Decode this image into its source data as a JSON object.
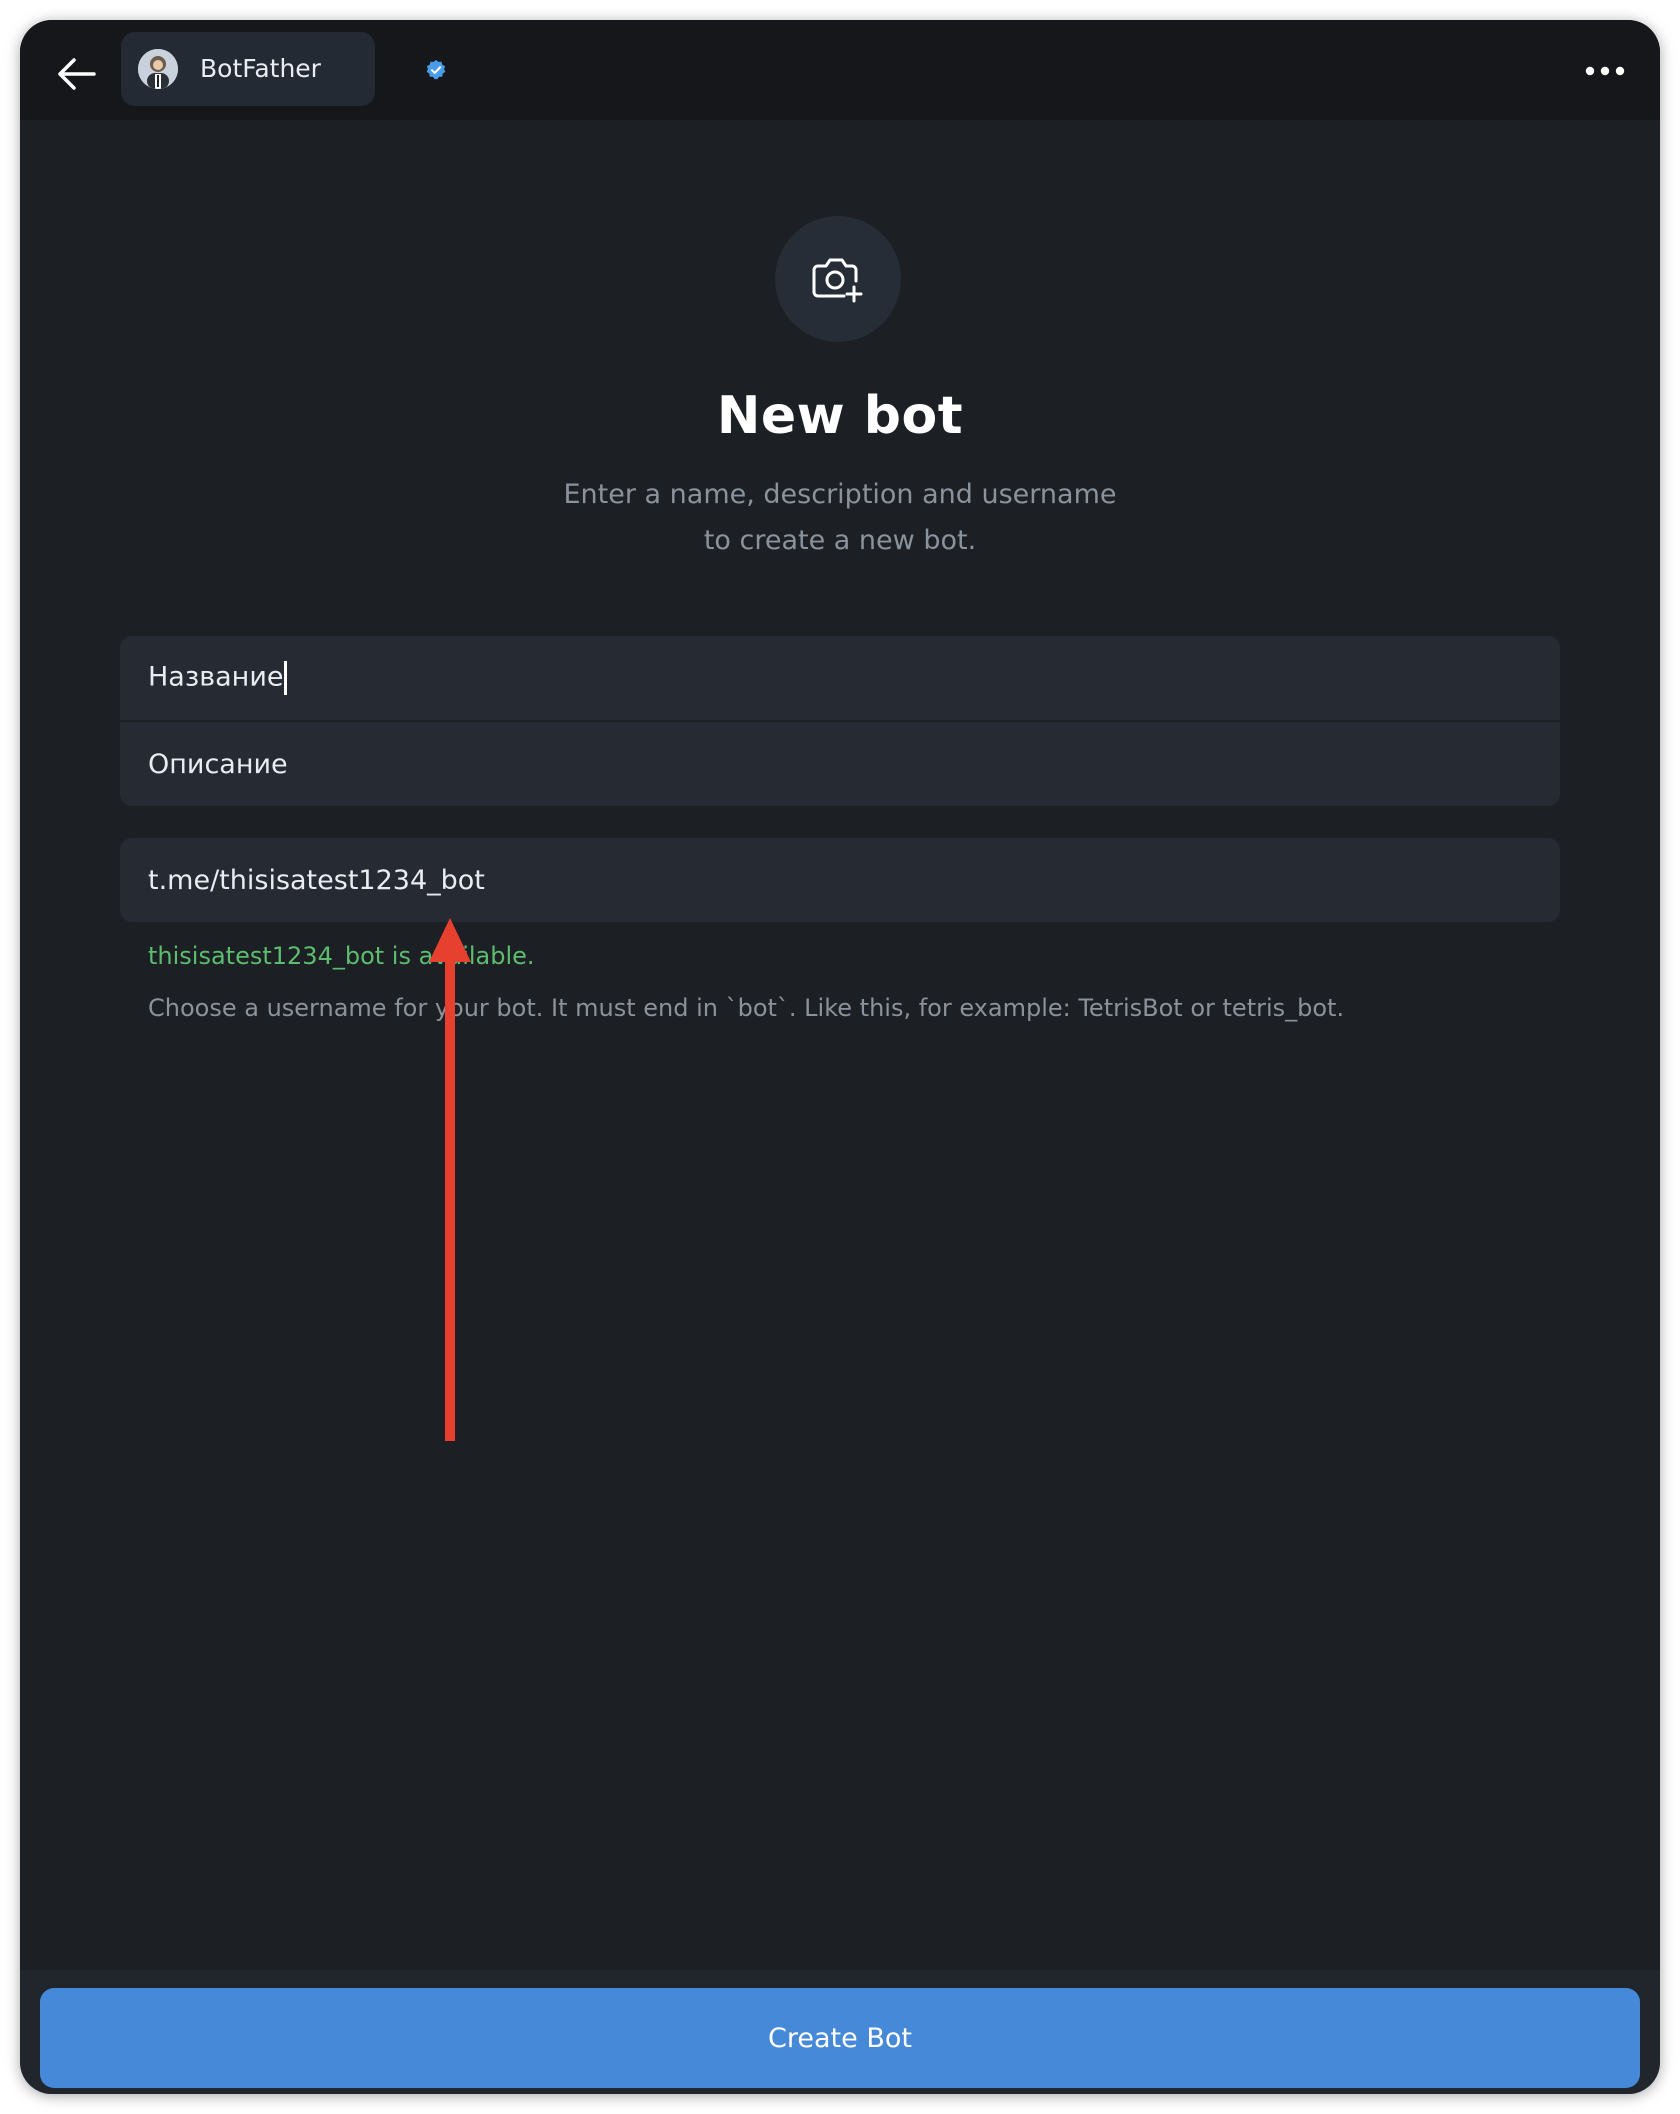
{
  "header": {
    "back_icon": "arrow-left-icon",
    "bot_name": "BotFather",
    "verified_icon": "verified-badge-icon",
    "more_icon": "more-horizontal-icon"
  },
  "main": {
    "photo_icon": "camera-add-icon",
    "title": "New bot",
    "subtitle_line1": "Enter a name, description and username",
    "subtitle_line2": "to create a new bot.",
    "name_field": {
      "value": "Название"
    },
    "description_field": {
      "value": "Описание"
    },
    "username_field": {
      "value": "t.me/thisisatest1234_bot"
    },
    "status_text": "thisisatest1234_bot is available.",
    "hint_text": "Choose a username for your bot. It must end in `bot`. Like this, for example: TetrisBot or tetris_bot."
  },
  "footer": {
    "create_button_label": "Create Bot"
  },
  "colors": {
    "accent": "#4689d8",
    "success": "#5cbd6e",
    "annotation_arrow": "#e8402e",
    "background": "#1c1f24",
    "field_background": "#252a33"
  }
}
